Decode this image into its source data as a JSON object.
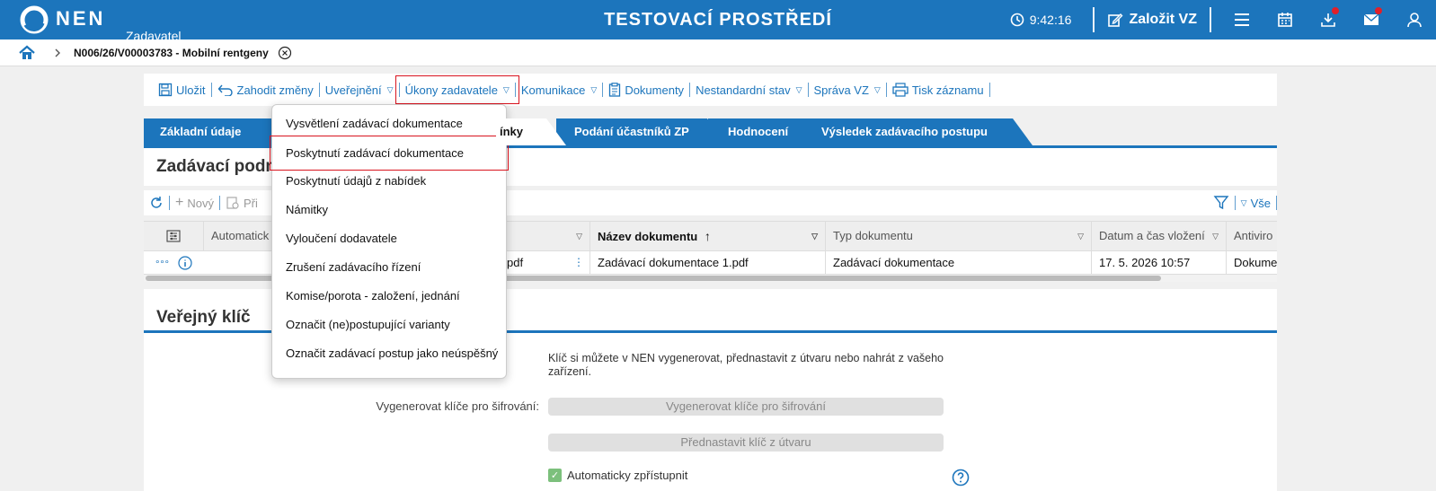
{
  "header": {
    "logo_text": "NEN",
    "logo_sub": "Zadavatel",
    "title": "TESTOVACÍ PROSTŘEDÍ",
    "time": "9:42:16",
    "new_vz_label": "Založit VZ",
    "icons": [
      "clock-icon",
      "edit-icon",
      "menu-icon",
      "calendar-icon",
      "download-icon",
      "mail-icon",
      "user-icon"
    ],
    "accent": "#1c75bc",
    "notify_color": "#e0202a"
  },
  "breadcrumb": {
    "text": "N006/26/V00003783 - Mobilní rentgeny"
  },
  "toolbar": {
    "items": [
      {
        "label": "Uložit",
        "icon": "save-icon",
        "caret": false
      },
      {
        "label": "Zahodit změny",
        "icon": "undo-icon",
        "caret": false
      },
      {
        "label": "Uveřejnění",
        "icon": "",
        "caret": true
      },
      {
        "label": "Úkony zadavatele",
        "icon": "",
        "caret": true
      },
      {
        "label": "Komunikace",
        "icon": "",
        "caret": true
      },
      {
        "label": "Dokumenty",
        "icon": "document-icon",
        "caret": false
      },
      {
        "label": "Nestandardní stav",
        "icon": "",
        "caret": true
      },
      {
        "label": "Správa VZ",
        "icon": "",
        "caret": true
      },
      {
        "label": "Tisk záznamu",
        "icon": "print-icon",
        "caret": false
      }
    ],
    "caret": "▽"
  },
  "tabs": [
    {
      "label": "Základní údaje"
    },
    {
      "label": "ínky"
    },
    {
      "label": "Podání účastníků ZP"
    },
    {
      "label": "Hodnocení"
    },
    {
      "label": "Výsledek zadávacího postupu"
    }
  ],
  "section1": {
    "title": "Zadávací podmí"
  },
  "gridbar": {
    "new_label": "Nový",
    "add_label": "Při",
    "all_label": "Vše"
  },
  "table": {
    "columns": [
      {
        "label": "Automatick",
        "tri": ""
      },
      {
        "label": "",
        "tri": "▽"
      },
      {
        "label": "Název dokumentu",
        "tri": "▽"
      },
      {
        "label": "Typ dokumentu",
        "tri": "▽"
      },
      {
        "label": "Datum a čas vložení",
        "tri": "▽"
      },
      {
        "label": "Antiviro",
        "tri": ""
      }
    ],
    "rows": [
      {
        "actions": "∘∘∘",
        "file_tail": "pdf",
        "name": "Zadávací dokumentace 1.pdf",
        "type": "Zadávací dokumentace",
        "datetime": "17. 5. 2026 10:57",
        "antivirus": "Dokume"
      }
    ]
  },
  "section2": {
    "title": "Veřejný klíč",
    "info": "Klíč si můžete v NEN vygenerovat, přednastavit z útvaru nebo nahrát z vašeho zařízení.",
    "gen_label": "Vygenerovat klíče pro šifrování:",
    "gen_button": "Vygenerovat klíče pro šifrování",
    "preset_button": "Přednastavit klíč z útvaru",
    "auto_label": "Automaticky zpřístupnit",
    "checked": true
  },
  "dropdown": {
    "items": [
      {
        "label": "Vysvětlení zadávací dokumentace"
      },
      {
        "label": "Poskytnutí zadávací dokumentace"
      },
      {
        "label": "Poskytnutí údajů z nabídek"
      },
      {
        "label": "Námitky"
      },
      {
        "label": "Vyloučení dodavatele"
      },
      {
        "label": "Zrušení zadávacího řízení"
      },
      {
        "label": "Komise/porota - založení, jednání"
      },
      {
        "label": "Označit (ne)postupující varianty"
      },
      {
        "label": "Označit zadávací postup jako neúspěšný"
      }
    ]
  }
}
